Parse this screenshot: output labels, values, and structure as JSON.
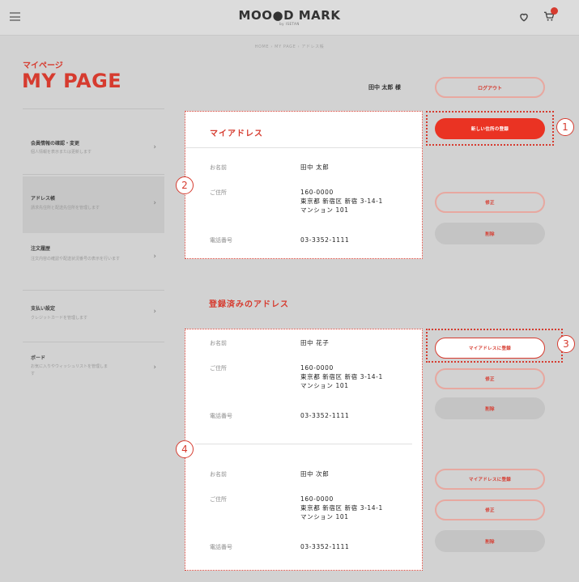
{
  "header": {
    "logo": "MOO●D MARK",
    "logo_sub": "by ISETAN"
  },
  "breadcrumb": "HOME › MY PAGE › アドレス帳",
  "page": {
    "title_jp": "マイページ",
    "title_en": "MY PAGE",
    "username": "田中 太郎 様",
    "logout_label": "ログアウト"
  },
  "sidebar": {
    "items": [
      {
        "title": "会員情報の確認・変更",
        "desc": "個人情報を表示または更新します"
      },
      {
        "title": "アドレス帳",
        "desc": "請求先住所と配送先住所を管理します"
      },
      {
        "title": "注文履歴",
        "desc": "注文内容の確認や配送状況番号の表示を行います"
      },
      {
        "title": "支払い設定",
        "desc": "クレジットカードを管理します"
      },
      {
        "title": "ボード",
        "desc": "お気に入りやウィッシュリストを管理します"
      }
    ]
  },
  "labels": {
    "name": "お名前",
    "address": "ご住所",
    "phone": "電話番号"
  },
  "my_address": {
    "title": "マイアドレス",
    "name": "田中 太郎",
    "address": "160-0000\n東京都 新宿区 新宿 3-14-1\nマンション 101",
    "phone": "03-3352-1111"
  },
  "registered": {
    "title": "登録済みのアドレス",
    "entries": [
      {
        "name": "田中 花子",
        "address": "160-0000\n東京都 新宿区 新宿 3-14-1\nマンション 101",
        "phone": "03-3352-1111"
      },
      {
        "name": "田中 次郎",
        "address": "160-0000\n東京都 新宿区 新宿 3-14-1\nマンション 101",
        "phone": "03-3352-1111"
      }
    ]
  },
  "buttons": {
    "new_address": "新しい住所の登録",
    "edit": "修正",
    "delete": "削除",
    "set_my_address": "マイアドレスに登録"
  },
  "callouts": [
    "1",
    "2",
    "3",
    "4"
  ],
  "colors": {
    "accent": "#d63b2f",
    "button_red": "#ea3323"
  }
}
